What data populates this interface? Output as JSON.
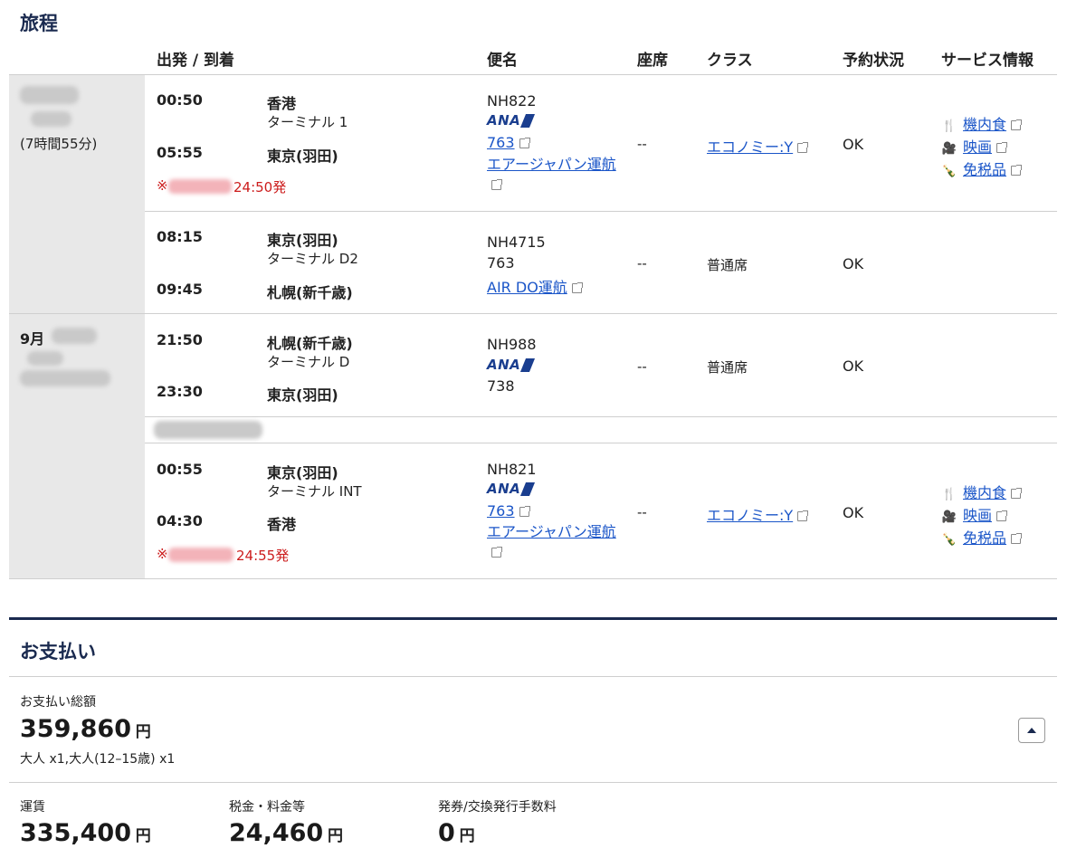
{
  "itinerary": {
    "title": "旅程",
    "columns": {
      "depart_arrive": "出発 / 到着",
      "flight": "便名",
      "seat": "座席",
      "class": "クラス",
      "status": "予約状況",
      "service": "サービス情報"
    },
    "duration1": "(7時間55分)",
    "date2_prefix": "9月",
    "seg1": {
      "dep_time": "00:50",
      "dep_city": "香港",
      "dep_terminal": "ターミナル 1",
      "arr_time": "05:55",
      "arr_city": "東京(羽田)",
      "note_prefix": "※",
      "note_suffix": "24:50発",
      "flight_no": "NH822",
      "airline_logo": "ANA",
      "aircraft": "763",
      "operator": "エアージャパン運航",
      "seat": "--",
      "class": "エコノミー:Y",
      "status": "OK",
      "services": [
        "機内食",
        "映画",
        "免税品"
      ]
    },
    "seg2": {
      "dep_time": "08:15",
      "dep_city": "東京(羽田)",
      "dep_terminal": "ターミナル D2",
      "arr_time": "09:45",
      "arr_city": "札幌(新千歳)",
      "flight_no": "NH4715",
      "aircraft": "763",
      "operator": "AIR DO運航",
      "seat": "--",
      "class": "普通席",
      "status": "OK"
    },
    "seg3": {
      "dep_time": "21:50",
      "dep_city": "札幌(新千歳)",
      "dep_terminal": "ターミナル D",
      "arr_time": "23:30",
      "arr_city": "東京(羽田)",
      "flight_no": "NH988",
      "airline_logo": "ANA",
      "aircraft": "738",
      "seat": "--",
      "class": "普通席",
      "status": "OK"
    },
    "seg4": {
      "dep_time": "00:55",
      "dep_city": "東京(羽田)",
      "dep_terminal": "ターミナル INT",
      "arr_time": "04:30",
      "arr_city": "香港",
      "note_prefix": "※",
      "note_suffix": "24:55発",
      "flight_no": "NH821",
      "airline_logo": "ANA",
      "aircraft": "763",
      "operator": "エアージャパン運航",
      "seat": "--",
      "class": "エコノミー:Y",
      "status": "OK",
      "services": [
        "機内食",
        "映画",
        "免税品"
      ]
    }
  },
  "payment": {
    "title": "お支払い",
    "total_label": "お支払い総額",
    "total_amount": "359,860",
    "yen": "円",
    "passengers": "大人 x1,大人(12–15歳) x1",
    "fare_label": "運賃",
    "fare_amount": "335,400",
    "tax_label": "税金・料金等",
    "tax_amount": "24,460",
    "fee_label": "発券/交換発行手数料",
    "fee_amount": "0"
  },
  "colors": {
    "navy": "#1a2a4f",
    "link": "#1a55c8",
    "red": "#cc1c1c",
    "gray_bg": "#e8e8e8"
  }
}
